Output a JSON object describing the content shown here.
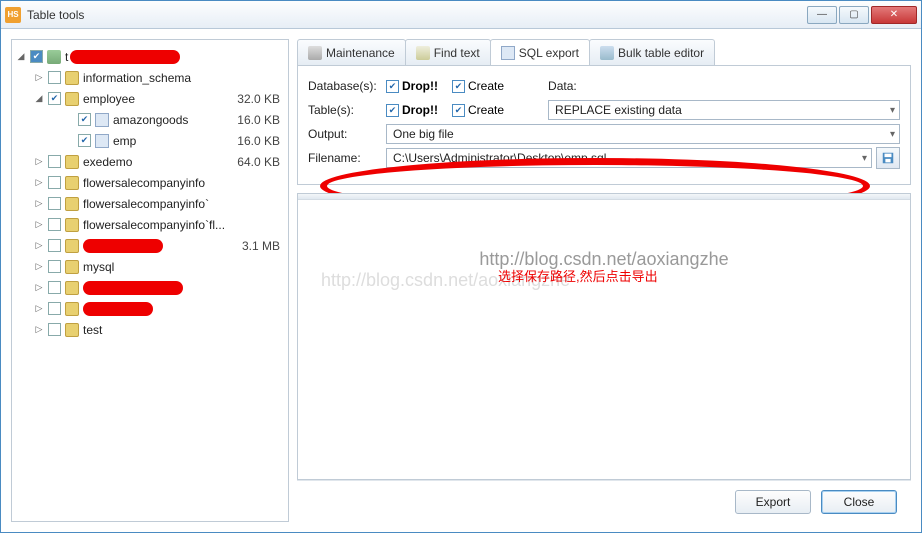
{
  "window": {
    "title": "Table tools"
  },
  "winbtns": {
    "min": "—",
    "max": "▢",
    "close": "✕"
  },
  "tree": {
    "root": {
      "label": "t"
    },
    "items": [
      {
        "label": "information_schema",
        "size": ""
      },
      {
        "label": "employee",
        "size": "32.0 KB",
        "checked": true,
        "expanded": true
      },
      {
        "label": "amazongoods",
        "size": "16.0 KB",
        "checked": true,
        "table": true
      },
      {
        "label": "emp",
        "size": "16.0 KB",
        "checked": true,
        "table": true
      },
      {
        "label": "exedemo",
        "size": "64.0 KB"
      },
      {
        "label": "flowersalecompanyinfo",
        "size": ""
      },
      {
        "label": "flowersalecompanyinfo`",
        "size": ""
      },
      {
        "label": "flowersalecompanyinfo`fl...",
        "size": ""
      },
      {
        "label": "",
        "size": "3.1 MB",
        "redact": 80
      },
      {
        "label": "mysql",
        "size": ""
      },
      {
        "label": "",
        "size": "",
        "redact": 100
      },
      {
        "label": "",
        "size": "",
        "redact": 70
      },
      {
        "label": "test",
        "size": ""
      }
    ]
  },
  "tabs": {
    "maintenance": "Maintenance",
    "find": "Find text",
    "sql": "SQL export",
    "bulk": "Bulk table editor"
  },
  "form": {
    "databases_label": "Database(s):",
    "tables_label": "Table(s):",
    "drop_label": "Drop!!",
    "create_label": "Create",
    "data_label": "Data:",
    "data_select": "REPLACE existing data",
    "output_label": "Output:",
    "output_select": "One big file",
    "filename_label": "Filename:",
    "filename_value": "C:\\Users\\Administrator\\Desktop\\emp.sql"
  },
  "watermark": "http://blog.csdn.net/aoxiangzhe",
  "annotation": "选择保存路径,然后点击导出",
  "footer": {
    "export": "Export",
    "close": "Close"
  }
}
